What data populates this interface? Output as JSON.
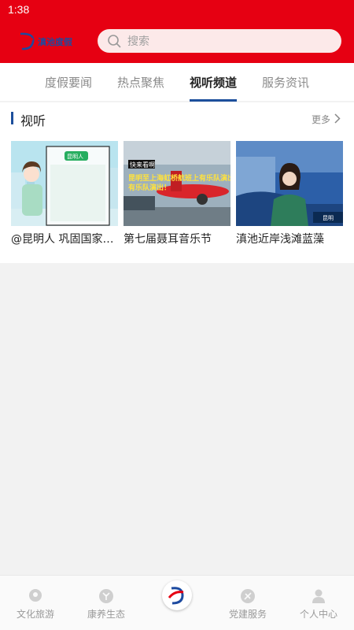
{
  "status_bar": {
    "time": "1:38"
  },
  "header": {
    "logo_text": "滇池度假",
    "search_placeholder": "搜索"
  },
  "tabs": [
    {
      "label": "度假要闻",
      "active": false
    },
    {
      "label": "热点聚焦",
      "active": false
    },
    {
      "label": "视听频道",
      "active": true
    },
    {
      "label": "服务资讯",
      "active": false
    }
  ],
  "section": {
    "title": "视听",
    "more_label": "更多",
    "cards": [
      {
        "title": "@昆明人 巩固国家卫生城市成果",
        "thumb_caption": "昆明人"
      },
      {
        "title": "第七届聂耳音乐节",
        "thumb_badge": "快来看啊",
        "thumb_caption": "昆明至上海虹桥航班上有乐队演出！"
      },
      {
        "title": "滇池近岸浅滩蓝藻",
        "thumb_badge": "昆明"
      }
    ]
  },
  "bottom_nav": [
    {
      "label": "文化旅游"
    },
    {
      "label": "康养生态"
    },
    {
      "label": ""
    },
    {
      "label": "党建服务"
    },
    {
      "label": "个人中心"
    }
  ],
  "colors": {
    "header_red": "#e60012",
    "accent_blue": "#1d4f9c",
    "search_bg": "#fce9e9"
  }
}
